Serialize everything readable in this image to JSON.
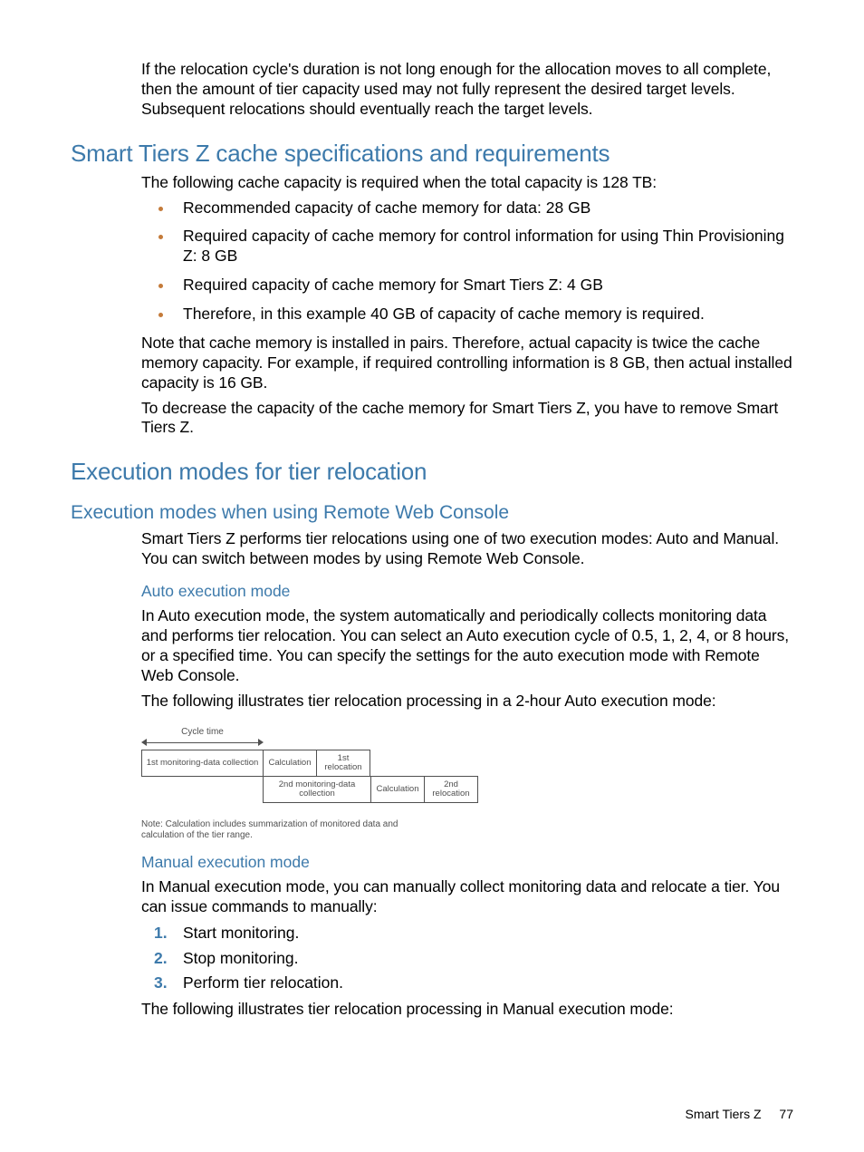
{
  "intro": "If the relocation cycle's duration is not long enough for the allocation moves to all complete, then the amount of tier capacity used may not fully represent the desired target levels. Subsequent relocations should eventually reach the target levels.",
  "section1": {
    "title": "Smart Tiers Z cache specifications and requirements",
    "lead": "The following cache capacity is required when the total capacity is 128 TB:",
    "bullets": [
      "Recommended capacity of cache memory for data: 28 GB",
      "Required capacity of cache memory for control information for using Thin Provisioning Z: 8 GB",
      "Required capacity of cache memory for Smart Tiers Z: 4 GB",
      "Therefore, in this example 40 GB of capacity of cache memory is required."
    ],
    "para1": "Note that cache memory is installed in pairs. Therefore, actual capacity is twice the cache memory capacity. For example, if required controlling information is 8 GB, then actual installed capacity is 16 GB.",
    "para2": "To decrease the capacity of the cache memory for Smart Tiers Z, you have to remove Smart Tiers Z."
  },
  "section2": {
    "title": "Execution modes for tier relocation",
    "sub1": {
      "title": "Execution modes when using Remote Web Console",
      "para": "Smart Tiers Z performs tier relocations using one of two execution modes: Auto and Manual. You can switch between modes by using Remote Web Console."
    },
    "auto": {
      "title": "Auto execution mode",
      "para1": "In Auto execution mode, the system automatically and periodically collects monitoring data and performs tier relocation. You can select an Auto execution cycle of 0.5, 1, 2, 4, or 8 hours, or a specified time. You can specify the settings for the auto execution mode with Remote Web Console.",
      "para2": "The following illustrates tier relocation processing in a 2-hour Auto execution mode:"
    },
    "diagram": {
      "cycle": "Cycle time",
      "row1": {
        "monitor": "1st monitoring-data collection",
        "calc": "Calculation",
        "reloc": "1st relocation"
      },
      "row2": {
        "monitor": "2nd monitoring-data collection",
        "calc": "Calculation",
        "reloc": "2nd relocation"
      },
      "note": "Note: Calculation includes summarization of monitored data and calculation of the tier range."
    },
    "manual": {
      "title": "Manual execution mode",
      "para1": "In Manual execution mode, you can manually collect monitoring data and relocate a tier. You can issue commands to manually:",
      "steps": [
        "Start monitoring.",
        "Stop monitoring.",
        "Perform tier relocation."
      ],
      "para2": "The following illustrates tier relocation processing in Manual execution mode:"
    }
  },
  "footer": {
    "label": "Smart Tiers Z",
    "page": "77"
  }
}
